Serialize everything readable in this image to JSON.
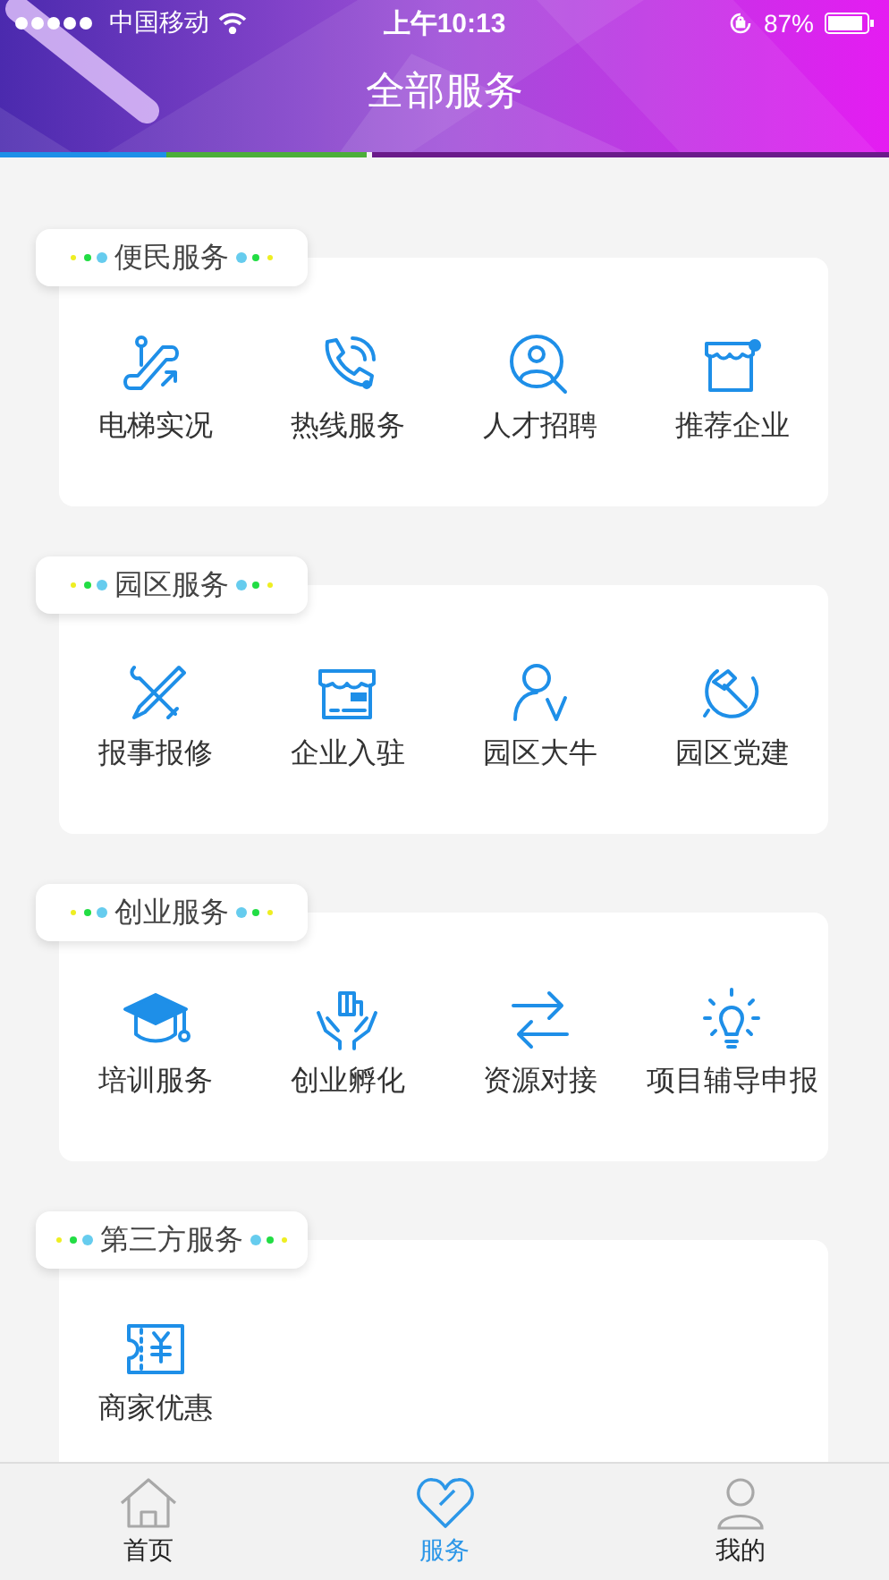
{
  "status_bar": {
    "carrier": "中国移动",
    "time": "上午10:13",
    "battery": "87%"
  },
  "title": "全部服务",
  "sections": [
    {
      "title": "便民服务",
      "items": [
        {
          "label": "电梯实况"
        },
        {
          "label": "热线服务"
        },
        {
          "label": "人才招聘"
        },
        {
          "label": "推荐企业"
        }
      ]
    },
    {
      "title": "园区服务",
      "items": [
        {
          "label": "报事报修"
        },
        {
          "label": "企业入驻"
        },
        {
          "label": "园区大牛"
        },
        {
          "label": "园区党建"
        }
      ]
    },
    {
      "title": "创业服务",
      "items": [
        {
          "label": "培训服务"
        },
        {
          "label": "创业孵化"
        },
        {
          "label": "资源对接"
        },
        {
          "label": "项目辅导申报"
        }
      ]
    },
    {
      "title": "第三方服务",
      "items": [
        {
          "label": "商家优惠"
        }
      ]
    }
  ],
  "tab_bar": [
    {
      "label": "首页",
      "selected": false
    },
    {
      "label": "服务",
      "selected": true
    },
    {
      "label": "我的",
      "selected": false
    }
  ]
}
